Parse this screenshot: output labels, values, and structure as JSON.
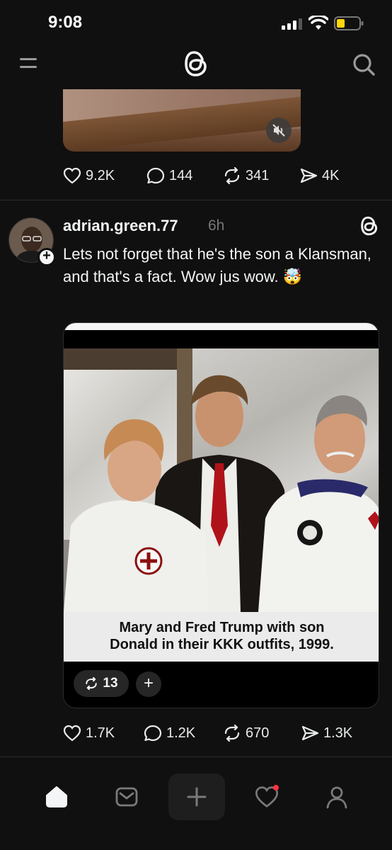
{
  "status_bar": {
    "time": "9:08"
  },
  "top_nav": {
    "menu_icon": "menu-icon",
    "logo_icon": "threads-logo-icon",
    "search_icon": "search-icon"
  },
  "previous_post": {
    "media_icon": "muted-speaker-icon",
    "stats": {
      "likes": "9.2K",
      "replies": "144",
      "reposts": "341",
      "shares": "4K"
    }
  },
  "post": {
    "username": "adrian.green.77",
    "timestamp": "6h",
    "text": "Lets not forget that he's the son a Klansman, and that's a fact. Wow jus wow. 🤯",
    "media": {
      "caption_line1": "Mary and Fred Trump with son",
      "caption_line2": "Donald in their KKK outfits, 1999.",
      "repost_count": "13",
      "add_label": "+"
    },
    "stats": {
      "likes": "1.7K",
      "replies": "1.2K",
      "reposts": "670",
      "shares": "1.3K"
    }
  },
  "bottom_nav": {
    "items": [
      "home-icon",
      "inbox-icon",
      "compose-icon",
      "activity-heart-icon",
      "profile-icon"
    ],
    "activity_has_notification": true
  },
  "colors": {
    "background": "#101010",
    "text": "#f3f5f7",
    "muted": "#777777",
    "notification": "#ff3040"
  }
}
